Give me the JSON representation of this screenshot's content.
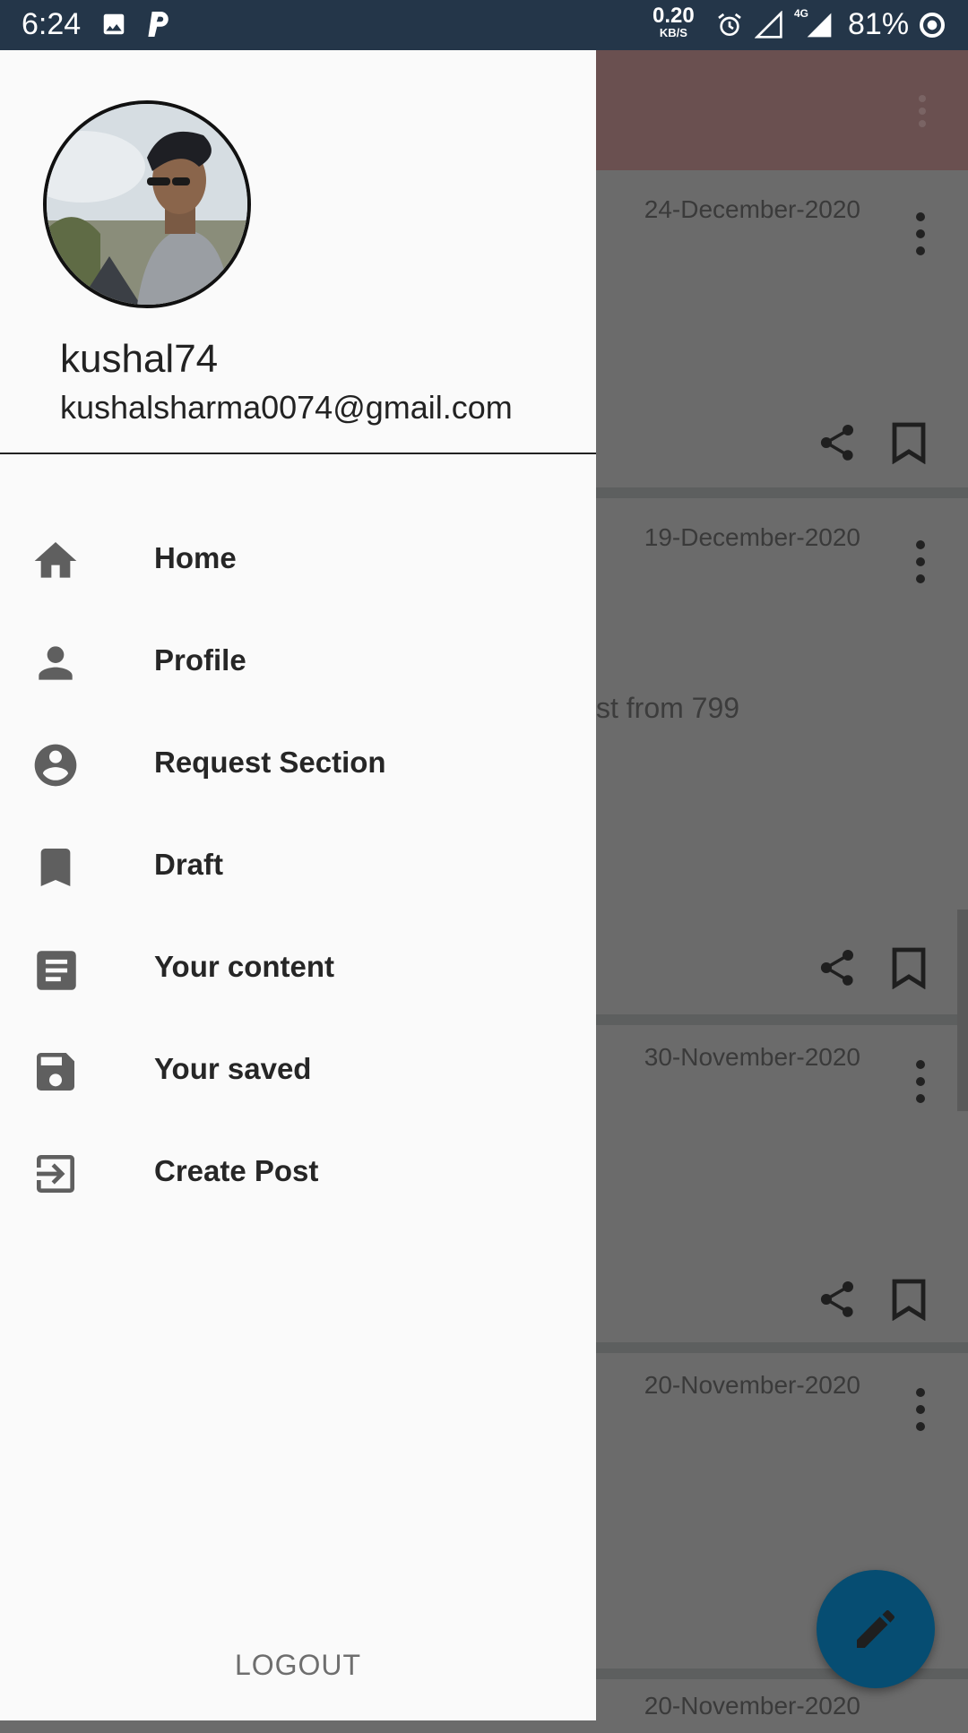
{
  "status_bar": {
    "time": "6:24",
    "net_speed_value": "0.20",
    "net_speed_unit": "KB/S",
    "network_type": "4G",
    "battery": "81%"
  },
  "drawer": {
    "user": {
      "name": "kushal74",
      "email": "kushalsharma0074@gmail.com"
    },
    "menu": [
      {
        "label": "Home",
        "icon": "home-icon"
      },
      {
        "label": "Profile",
        "icon": "person-icon"
      },
      {
        "label": "Request Section",
        "icon": "account-circle-icon"
      },
      {
        "label": "Draft",
        "icon": "bookmark-icon"
      },
      {
        "label": "Your content",
        "icon": "article-icon"
      },
      {
        "label": "Your saved",
        "icon": "save-icon"
      },
      {
        "label": "Create Post",
        "icon": "exit-to-app-icon"
      }
    ],
    "logout_label": "LOGOUT"
  },
  "feed": {
    "cards": [
      {
        "date": "24-December-2020"
      },
      {
        "date": "19-December-2020",
        "snippet": "st from 799"
      },
      {
        "date": "30-November-2020"
      },
      {
        "date": "20-November-2020"
      },
      {
        "date": "20-November-2020"
      }
    ]
  },
  "colors": {
    "status_bar": "#243649",
    "drawer_bg": "#fafafa",
    "scrim": "#6b6b6b",
    "fab": "#064d72",
    "icon": "#5f5f5f"
  }
}
